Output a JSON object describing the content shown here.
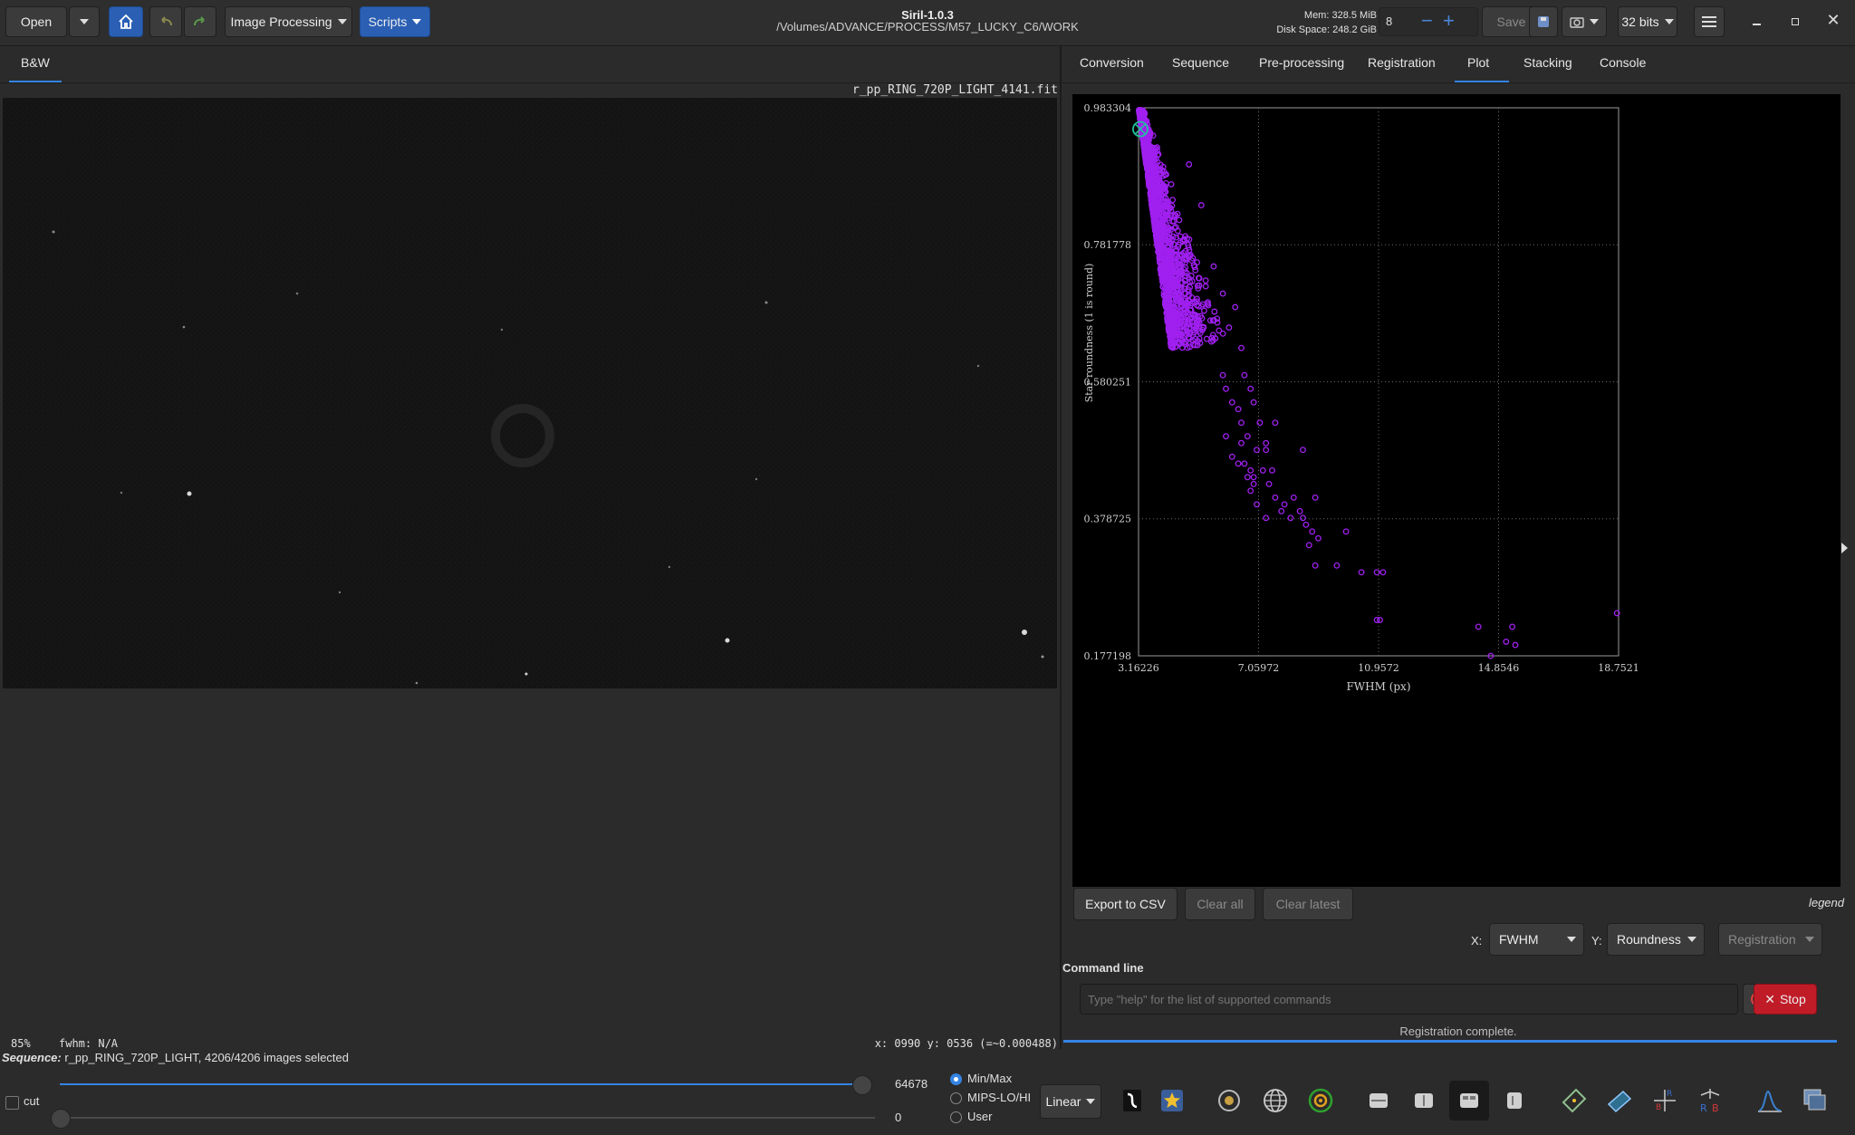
{
  "header": {
    "open_label": "Open",
    "image_processing_label": "Image Processing",
    "scripts_label": "Scripts",
    "title": "Siril-1.0.3",
    "path": "/Volumes/ADVANCE/PROCESS/M57_LUCKY_C6/WORK",
    "mem_label": "Mem: 328.5 MiB",
    "disk_label": "Disk Space: 248.2 GiB",
    "threads_value": "8",
    "save_label": "Save",
    "bits_label": "32 bits"
  },
  "left": {
    "tab_label": "B&W",
    "filename": "r_pp_RING_720P_LIGHT_4141.fit",
    "zoom": "85%",
    "fwhm": "fwhm: N/A",
    "coords": "x: 0990 y: 0536 (=~0.000488)"
  },
  "right": {
    "tabs": [
      "Conversion",
      "Sequence",
      "Pre-processing",
      "Registration",
      "Plot",
      "Stacking",
      "Console"
    ],
    "active_tab": "Plot",
    "export_label": "Export to CSV",
    "clear_all_label": "Clear all",
    "clear_latest_label": "Clear latest",
    "legend_label": "legend",
    "x_label": "X:",
    "x_value": "FWHM",
    "y_label": "Y:",
    "y_value": "Roundness",
    "layer_value": "Registration",
    "command_title": "Command line",
    "command_placeholder": "Type \"help\" for the list of supported commands",
    "stop_label": "Stop",
    "status": "Registration complete."
  },
  "bottom": {
    "sequence_prefix": "Sequence:",
    "sequence_text": " r_pp_RING_720P_LIGHT, 4206/4206 images selected",
    "cut_label": "cut",
    "high_value": "64678",
    "low_value": "0",
    "radio_minmax": "Min/Max",
    "radio_mips": "MIPS-LO/HI",
    "radio_user": "User",
    "scale_label": "Linear"
  },
  "colors": {
    "accent": "#3584e4",
    "points": "#a020f0",
    "stop": "#c01c28"
  },
  "chart_data": {
    "type": "scatter",
    "xlabel": "FWHM (px)",
    "ylabel": "Star roundness (1 is round)",
    "xlim": [
      3.16226,
      18.7521
    ],
    "ylim": [
      0.177198,
      0.983304
    ],
    "x_ticks": [
      "3.16226",
      "7.05972",
      "10.9572",
      "14.8546",
      "18.7521"
    ],
    "y_ticks": [
      "0.983304",
      "0.781778",
      "0.580251",
      "0.378725",
      "0.177198"
    ],
    "grid": true,
    "highlight": {
      "x": 3.16,
      "y": 0.952
    },
    "dense_cluster": {
      "x_range": [
        3.16,
        5.5
      ],
      "y_range": [
        0.62,
        0.98
      ]
    },
    "outliers": [
      [
        4.8,
        0.9
      ],
      [
        5.2,
        0.84
      ],
      [
        5.6,
        0.75
      ],
      [
        5.9,
        0.71
      ],
      [
        6.3,
        0.69
      ],
      [
        6.5,
        0.63
      ],
      [
        6.1,
        0.66
      ],
      [
        6.8,
        0.57
      ],
      [
        6.6,
        0.59
      ],
      [
        6.9,
        0.55
      ],
      [
        7.1,
        0.52
      ],
      [
        6.4,
        0.54
      ],
      [
        6.2,
        0.55
      ],
      [
        6.0,
        0.57
      ],
      [
        7.3,
        0.49
      ],
      [
        7.0,
        0.48
      ],
      [
        6.7,
        0.5
      ],
      [
        6.5,
        0.52
      ],
      [
        5.9,
        0.59
      ],
      [
        6.0,
        0.5
      ],
      [
        6.2,
        0.47
      ],
      [
        6.4,
        0.46
      ],
      [
        6.6,
        0.46
      ],
      [
        6.8,
        0.45
      ],
      [
        6.9,
        0.44
      ],
      [
        7.3,
        0.48
      ],
      [
        6.5,
        0.49
      ],
      [
        7.6,
        0.52
      ],
      [
        8.5,
        0.48
      ],
      [
        6.7,
        0.44
      ],
      [
        6.9,
        0.43
      ],
      [
        7.2,
        0.45
      ],
      [
        7.5,
        0.45
      ],
      [
        7.4,
        0.43
      ],
      [
        6.8,
        0.42
      ],
      [
        7.6,
        0.41
      ],
      [
        7.0,
        0.4
      ],
      [
        7.9,
        0.4
      ],
      [
        8.2,
        0.41
      ],
      [
        7.8,
        0.39
      ],
      [
        7.3,
        0.38
      ],
      [
        8.4,
        0.39
      ],
      [
        8.9,
        0.41
      ],
      [
        8.5,
        0.38
      ],
      [
        8.6,
        0.37
      ],
      [
        8.1,
        0.38
      ],
      [
        8.8,
        0.36
      ],
      [
        9.0,
        0.35
      ],
      [
        8.7,
        0.34
      ],
      [
        9.9,
        0.36
      ],
      [
        8.9,
        0.31
      ],
      [
        9.6,
        0.31
      ],
      [
        10.4,
        0.3
      ],
      [
        10.9,
        0.3
      ],
      [
        11.1,
        0.3
      ],
      [
        10.9,
        0.23
      ],
      [
        11.0,
        0.23
      ],
      [
        14.2,
        0.22
      ],
      [
        15.3,
        0.22
      ],
      [
        15.1,
        0.198
      ],
      [
        15.4,
        0.193
      ],
      [
        18.7,
        0.24
      ],
      [
        14.6,
        0.177
      ]
    ]
  }
}
